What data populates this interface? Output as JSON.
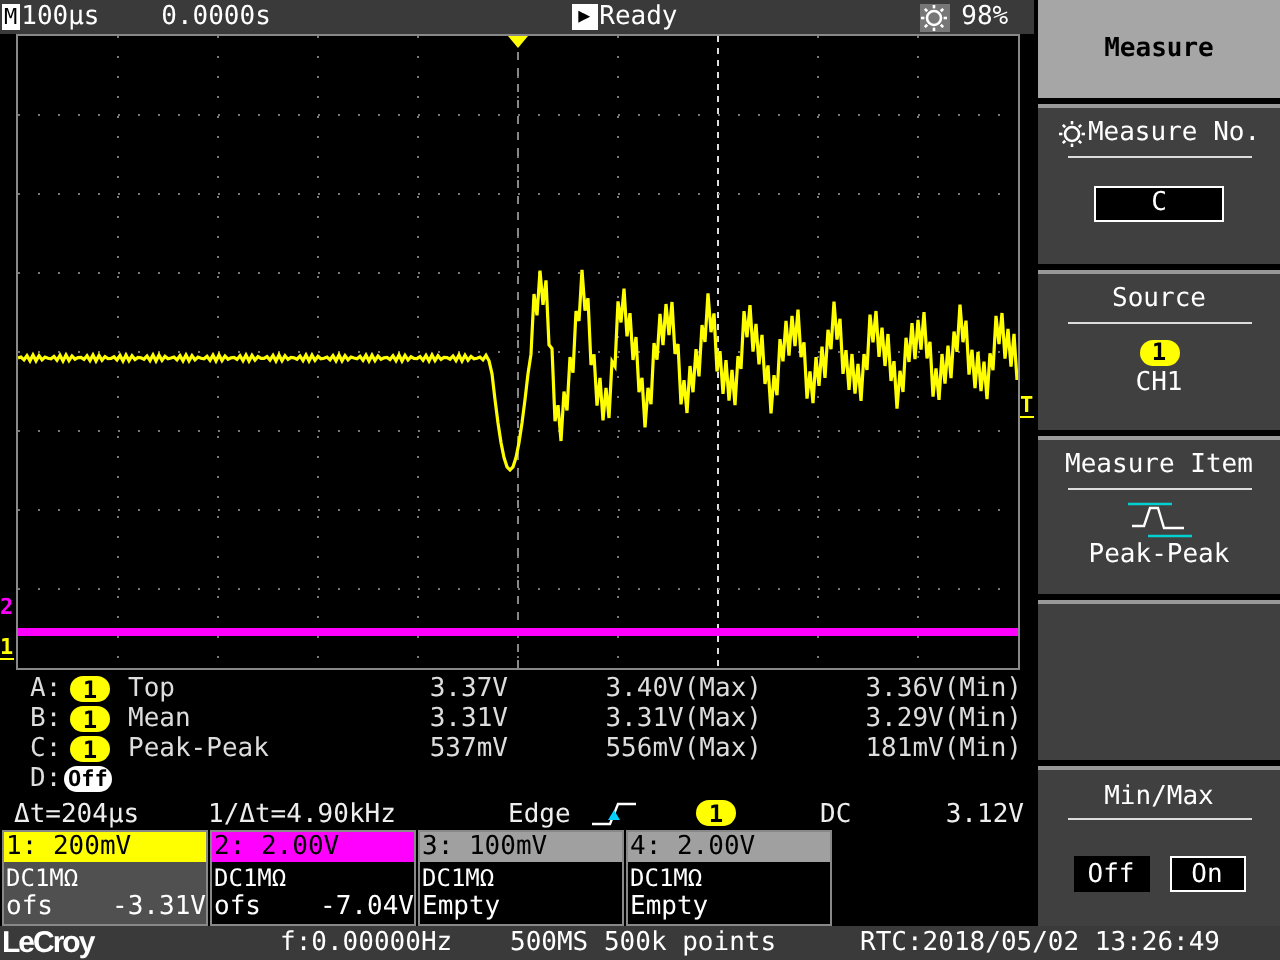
{
  "status_bar": {
    "mode_icon": "M",
    "timebase": "100µs",
    "delay": "0.0000s",
    "run_icon": "▶",
    "state": "Ready",
    "brightness": "98%"
  },
  "waveform": {
    "trigger_marker": "T",
    "channel_markers": [
      {
        "label": "2",
        "color": "#ff00ff"
      },
      {
        "label": "1",
        "color": "#ffff00"
      }
    ]
  },
  "measurements": [
    {
      "kind": "measure",
      "slot": "A:",
      "channel": "1",
      "item": "Top",
      "value": "3.37V",
      "max": "3.40V(Max)",
      "min": "3.36V(Min)"
    },
    {
      "kind": "measure",
      "slot": "B:",
      "channel": "1",
      "item": "Mean",
      "value": "3.31V",
      "max": "3.31V(Max)",
      "min": "3.29V(Min)"
    },
    {
      "kind": "measure",
      "slot": "C:",
      "channel": "1",
      "item": "Peak-Peak",
      "value": "537mV",
      "max": "556mV(Max)",
      "min": "181mV(Min)"
    },
    {
      "kind": "off",
      "slot": "D:",
      "channel": "Off"
    }
  ],
  "readout": {
    "delta_t": "Δt=204µs",
    "inverse": "1/Δt=4.90kHz",
    "trigger_type": "Edge",
    "trigger_source": "1",
    "coupling": "DC",
    "trigger_level": "3.12V"
  },
  "channels": [
    {
      "label": "1: 200mV",
      "color": "#ffff00",
      "selected": true,
      "coupling": "DC1MΩ",
      "line_left": "ofs",
      "line_right": "-3.31V"
    },
    {
      "label": "2: 2.00V",
      "color": "#ff00ff",
      "selected": false,
      "coupling": "DC1MΩ",
      "line_left": "ofs",
      "line_right": "-7.04V"
    },
    {
      "label": "3: 100mV",
      "color": "#a0a0a0",
      "selected": false,
      "coupling": "DC1MΩ",
      "line_left": "Empty"
    },
    {
      "label": "4: 2.00V",
      "color": "#a0a0a0",
      "selected": false,
      "coupling": "DC1MΩ",
      "line_left": "Empty"
    }
  ],
  "footer": {
    "brand": "LeCroy",
    "frequency": "f:0.00000Hz",
    "sampling": "500MS 500k points",
    "clock": "RTC:2018/05/02 13:26:49"
  },
  "menu": {
    "title": "Measure",
    "sections": [
      {
        "kind": "field",
        "title": "Measure No.",
        "value": "C"
      },
      {
        "kind": "source",
        "title": "Source",
        "badge": "1",
        "value": "CH1"
      },
      {
        "kind": "item",
        "title": "Measure Item",
        "value": "Peak-Peak"
      },
      {
        "kind": "empty"
      },
      {
        "kind": "toggle",
        "title": "Min/Max",
        "options": [
          {
            "label": "Off",
            "selected": false
          },
          {
            "label": "On",
            "selected": true
          }
        ]
      }
    ]
  }
}
